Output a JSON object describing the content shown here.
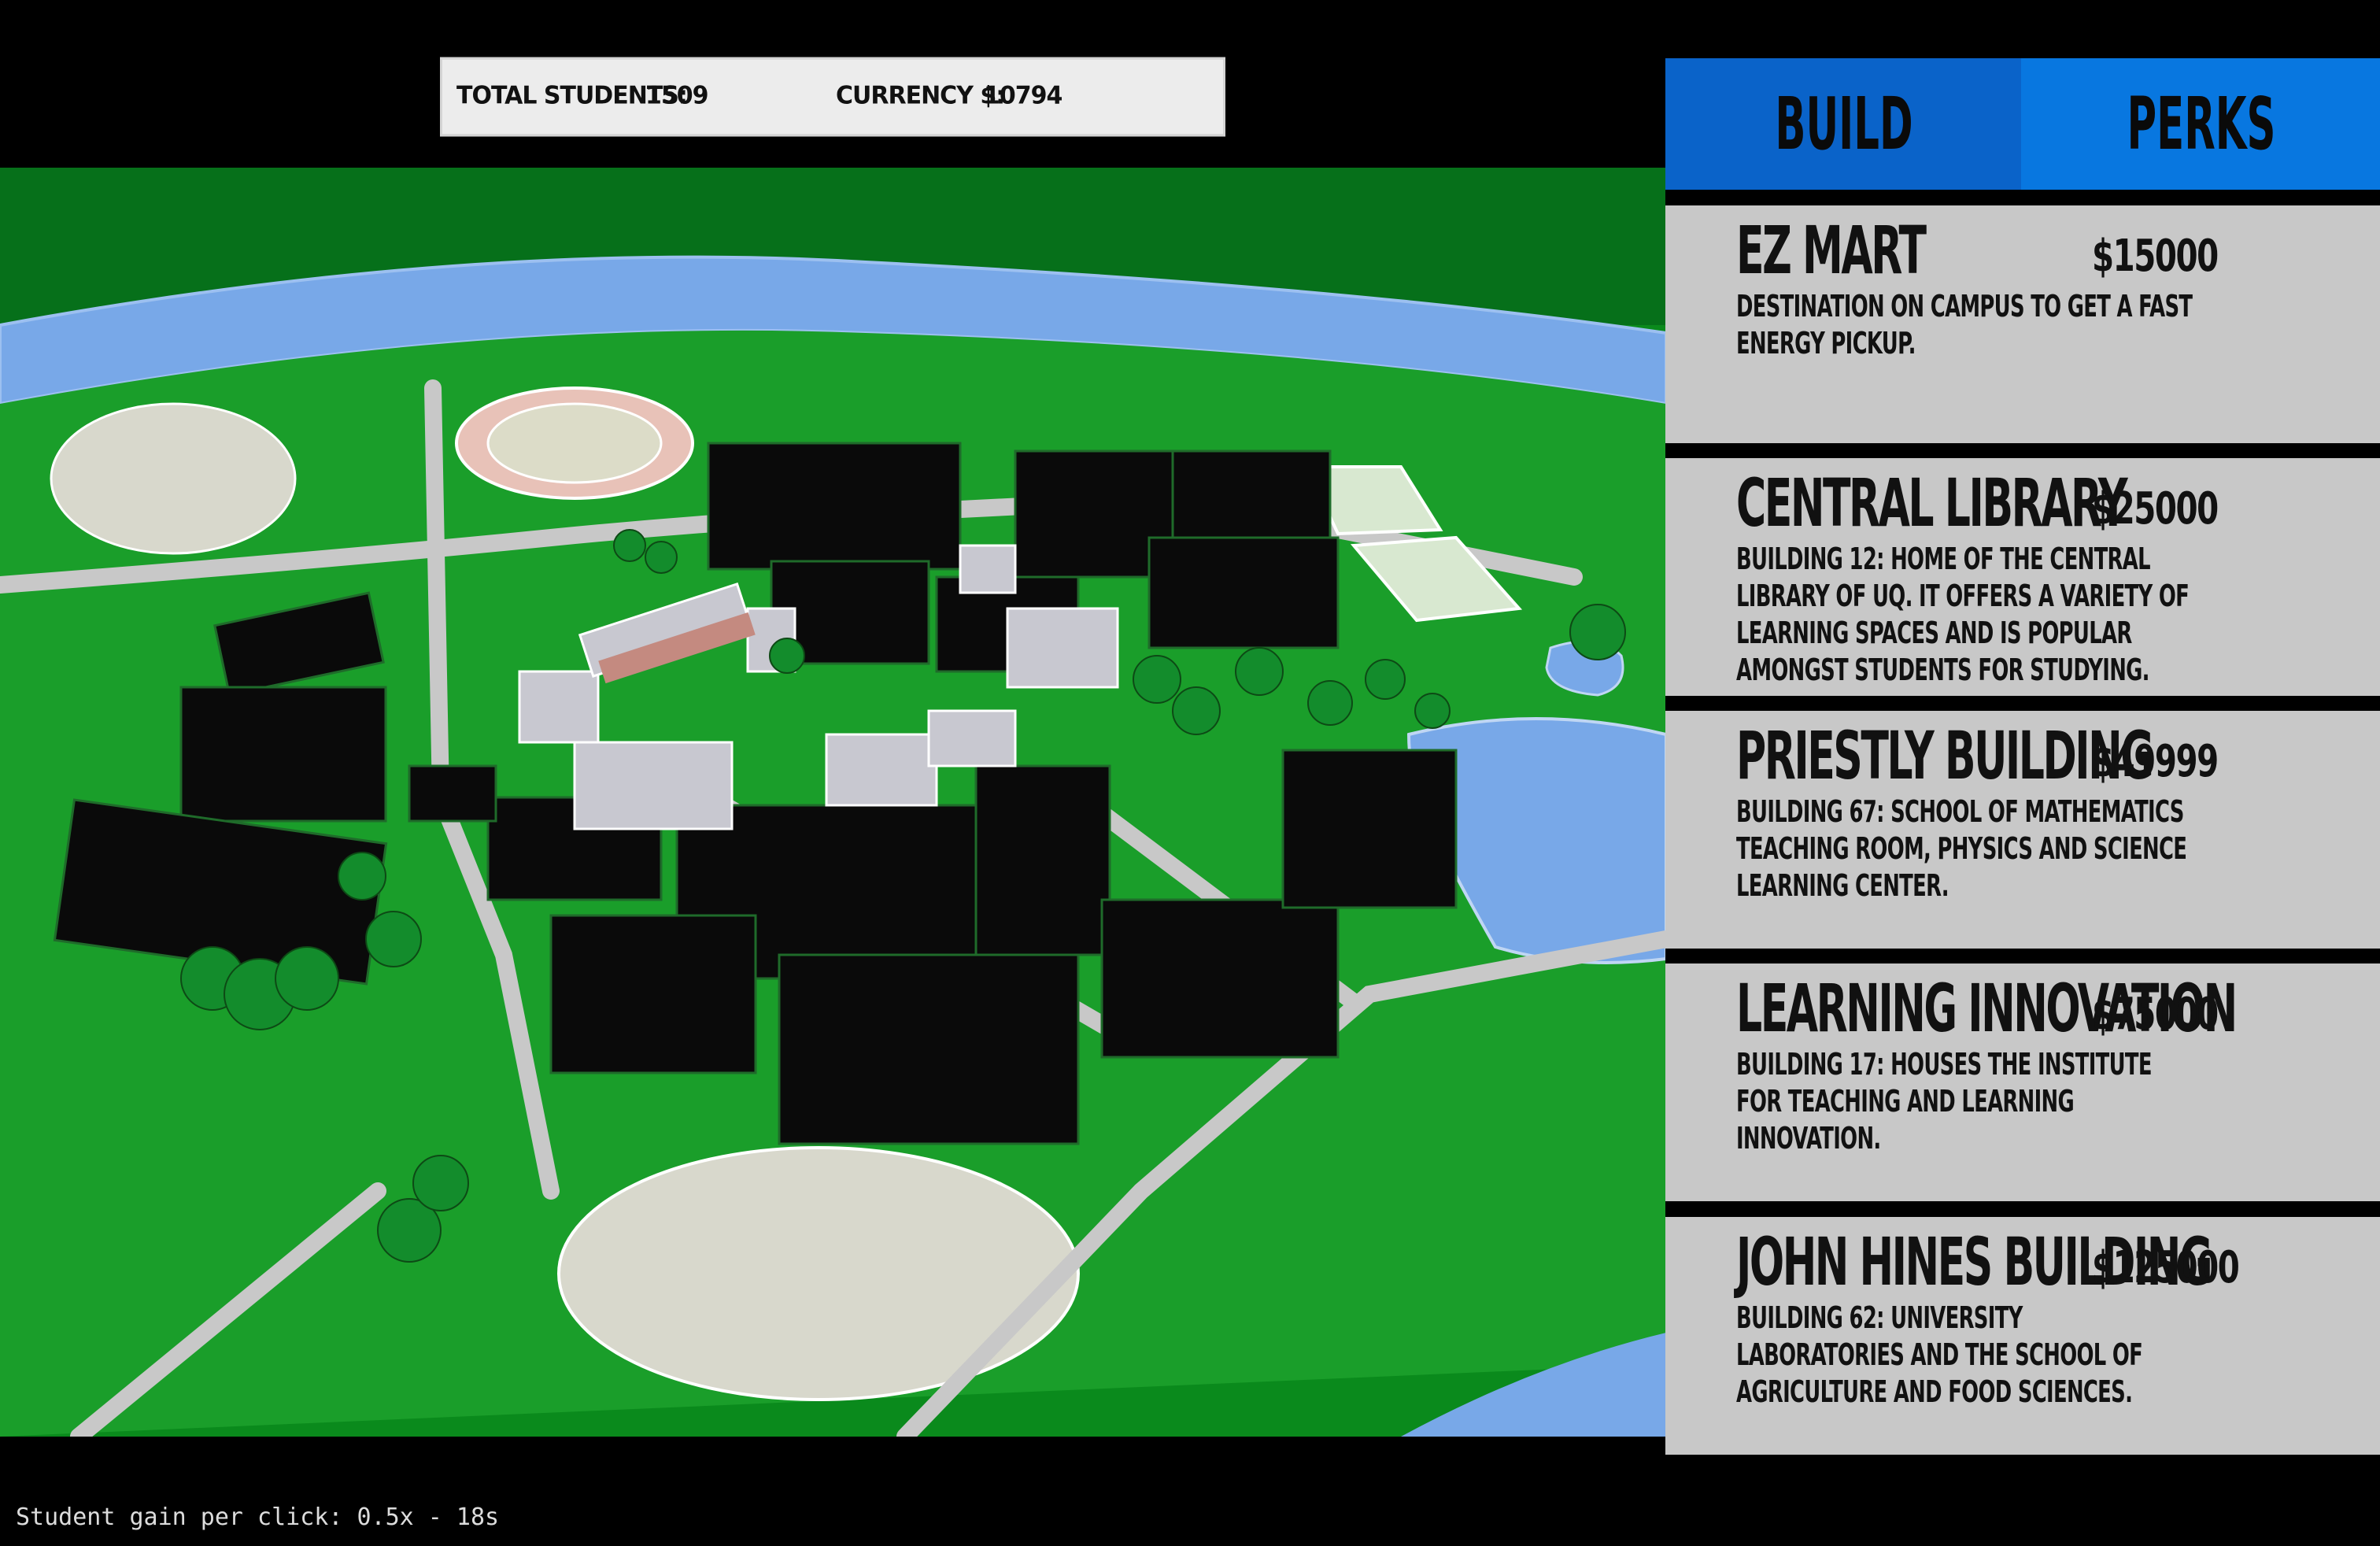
{
  "hud": {
    "students_label": "TOTAL STUDENTS:",
    "students_value": "1509",
    "currency_label": "CURRENCY $:",
    "currency_value": "10794"
  },
  "tabs": [
    {
      "label": "BUILD"
    },
    {
      "label": "PERKS"
    }
  ],
  "buildings": [
    {
      "name": "EZ MART",
      "price": "$15000",
      "desc": "DESTINATION ON CAMPUS TO GET A FAST ENERGY PICKUP."
    },
    {
      "name": "CENTRAL LIBRARY",
      "price": "$25000",
      "desc": "BUILDING 12: HOME OF THE CENTRAL LIBRARY OF UQ. IT OFFERS A VARIETY OF LEARNING SPACES AND IS POPULAR AMONGST STUDENTS FOR STUDYING."
    },
    {
      "name": "PRIESTLY BUILDING",
      "price": "$49999",
      "desc": "BUILDING 67: SCHOOL OF MATHEMATICS TEACHING ROOM, PHYSICS AND SCIENCE LEARNING CENTER."
    },
    {
      "name": "LEARNING INNOVATION",
      "price": "$75000",
      "desc": "BUILDING 17: HOUSES THE INSTITUTE FOR TEACHING AND LEARNING INNOVATION."
    },
    {
      "name": "JOHN HINES BUILDING",
      "price": "$125000",
      "desc": "BUILDING 62: UNIVERSITY LABORATORIES AND THE SCHOOL OF AGRICULTURE AND FOOD SCIENCES."
    }
  ],
  "status": {
    "text": "Student gain per click: 0.5x - 18s"
  },
  "colors": {
    "tab_build": "#0a63c9",
    "tab_perks": "#0877e0",
    "card_bg": "#c8c8c8",
    "grass": "#0e8f1f",
    "river": "#78a8e8"
  },
  "map": {
    "icon": "campus-map"
  }
}
